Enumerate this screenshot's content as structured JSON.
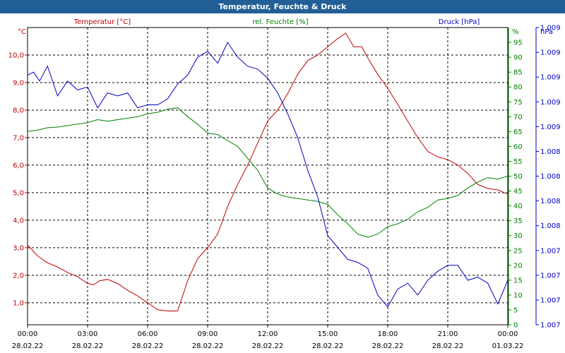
{
  "window": {
    "title": "Temperatur, Feuchte & Druck"
  },
  "colors": {
    "temperature": "#c00000",
    "humidity": "#008000",
    "pressure": "#0000c0",
    "grid": "#000000",
    "titlebar": "#215f96"
  },
  "chart_data": {
    "type": "line",
    "grid": "dashed, on",
    "x_ticks": [
      {
        "time": "00:00",
        "date": "28.02.22"
      },
      {
        "time": "03:00",
        "date": "28.02.22"
      },
      {
        "time": "06:00",
        "date": "28.02.22"
      },
      {
        "time": "09:00",
        "date": "28.02.22"
      },
      {
        "time": "12:00",
        "date": "28.02.22"
      },
      {
        "time": "15:00",
        "date": "28.02.22"
      },
      {
        "time": "18:00",
        "date": "28.02.22"
      },
      {
        "time": "21:00",
        "date": "28.02.22"
      },
      {
        "time": "00:00",
        "date": "01.03.22"
      }
    ],
    "x_range_hours": [
      0,
      24
    ],
    "axes": {
      "left": {
        "label": "Temperatur [°C]",
        "unit": "°C",
        "range": [
          0.2,
          11.0
        ],
        "ticks": [
          "1,0",
          "2,0",
          "3,0",
          "4,0",
          "5,0",
          "6,0",
          "7,0",
          "8,0",
          "9,0",
          "10,0"
        ]
      },
      "right1": {
        "label": "rel. Feuchte [%]",
        "unit": "%",
        "range": [
          0,
          100
        ],
        "ticks": [
          "0",
          "5",
          "10",
          "15",
          "20",
          "25",
          "30",
          "35",
          "40",
          "45",
          "50",
          "55",
          "60",
          "65",
          "70",
          "75",
          "80",
          "85",
          "90",
          "95"
        ]
      },
      "right2": {
        "label": "Druck [hPa]",
        "unit": "hPa",
        "range": [
          0,
          1
        ],
        "ticks": [
          "1.007",
          "1.007",
          "1.007",
          "1.007",
          "1.008",
          "1.008",
          "1.008",
          "1.008",
          "1.009",
          "1.009",
          "1.009",
          "1.009",
          "1.009"
        ]
      }
    },
    "series": [
      {
        "name": "Temperatur [°C]",
        "axis": "left",
        "points": [
          [
            0.0,
            3.1
          ],
          [
            0.5,
            2.7
          ],
          [
            1.0,
            2.45
          ],
          [
            1.5,
            2.3
          ],
          [
            2.0,
            2.1
          ],
          [
            2.5,
            1.95
          ],
          [
            3.0,
            1.7
          ],
          [
            3.3,
            1.65
          ],
          [
            3.6,
            1.8
          ],
          [
            4.0,
            1.85
          ],
          [
            4.5,
            1.7
          ],
          [
            5.0,
            1.45
          ],
          [
            5.5,
            1.25
          ],
          [
            6.0,
            1.0
          ],
          [
            6.5,
            0.75
          ],
          [
            7.0,
            0.7
          ],
          [
            7.5,
            0.7
          ],
          [
            8.0,
            1.8
          ],
          [
            8.5,
            2.6
          ],
          [
            9.0,
            3.0
          ],
          [
            9.5,
            3.5
          ],
          [
            10.0,
            4.5
          ],
          [
            10.5,
            5.3
          ],
          [
            11.0,
            6.0
          ],
          [
            11.5,
            6.8
          ],
          [
            12.0,
            7.6
          ],
          [
            12.5,
            8.0
          ],
          [
            13.0,
            8.6
          ],
          [
            13.5,
            9.3
          ],
          [
            14.0,
            9.8
          ],
          [
            14.5,
            10.0
          ],
          [
            15.0,
            10.3
          ],
          [
            15.5,
            10.6
          ],
          [
            15.9,
            10.8
          ],
          [
            16.3,
            10.3
          ],
          [
            16.7,
            10.3
          ],
          [
            17.0,
            9.9
          ],
          [
            17.5,
            9.3
          ],
          [
            18.0,
            8.8
          ],
          [
            18.5,
            8.2
          ],
          [
            19.0,
            7.6
          ],
          [
            19.5,
            7.0
          ],
          [
            20.0,
            6.5
          ],
          [
            20.5,
            6.3
          ],
          [
            21.0,
            6.2
          ],
          [
            21.5,
            6.0
          ],
          [
            22.0,
            5.7
          ],
          [
            22.5,
            5.3
          ],
          [
            23.0,
            5.15
          ],
          [
            23.5,
            5.1
          ],
          [
            24.0,
            4.95
          ]
        ]
      },
      {
        "name": "rel. Feuchte [%]",
        "axis": "right1",
        "points": [
          [
            0.0,
            65
          ],
          [
            0.5,
            65.5
          ],
          [
            1.0,
            66.3
          ],
          [
            1.5,
            66.5
          ],
          [
            2.0,
            67
          ],
          [
            2.5,
            67.5
          ],
          [
            3.0,
            68
          ],
          [
            3.5,
            69
          ],
          [
            4.0,
            68.5
          ],
          [
            4.5,
            69
          ],
          [
            5.0,
            69.5
          ],
          [
            5.5,
            70
          ],
          [
            6.0,
            71
          ],
          [
            6.5,
            71.5
          ],
          [
            7.0,
            72.5
          ],
          [
            7.5,
            73
          ],
          [
            8.0,
            70
          ],
          [
            8.5,
            67.5
          ],
          [
            9.0,
            64.5
          ],
          [
            9.5,
            64
          ],
          [
            10.0,
            62
          ],
          [
            10.5,
            60
          ],
          [
            11.0,
            56
          ],
          [
            11.5,
            52
          ],
          [
            12.0,
            46
          ],
          [
            12.5,
            44
          ],
          [
            13.0,
            43
          ],
          [
            13.5,
            42.5
          ],
          [
            14.0,
            42
          ],
          [
            14.5,
            41.5
          ],
          [
            15.0,
            40.5
          ],
          [
            15.5,
            37
          ],
          [
            16.0,
            34
          ],
          [
            16.5,
            30.5
          ],
          [
            17.0,
            29.5
          ],
          [
            17.5,
            30.5
          ],
          [
            18.0,
            33
          ],
          [
            18.5,
            34
          ],
          [
            19.0,
            35.5
          ],
          [
            19.5,
            38
          ],
          [
            20.0,
            39.5
          ],
          [
            20.5,
            42
          ],
          [
            21.0,
            42.5
          ],
          [
            21.5,
            43.5
          ],
          [
            22.0,
            46
          ],
          [
            22.5,
            48
          ],
          [
            23.0,
            49.5
          ],
          [
            23.5,
            49
          ],
          [
            24.0,
            50
          ]
        ]
      },
      {
        "name": "Druck [hPa]",
        "axis": "right2",
        "points": [
          [
            0.0,
            0.84
          ],
          [
            0.3,
            0.85
          ],
          [
            0.6,
            0.82
          ],
          [
            1.0,
            0.87
          ],
          [
            1.5,
            0.77
          ],
          [
            2.0,
            0.82
          ],
          [
            2.5,
            0.79
          ],
          [
            3.0,
            0.8
          ],
          [
            3.5,
            0.73
          ],
          [
            4.0,
            0.78
          ],
          [
            4.5,
            0.77
          ],
          [
            5.0,
            0.78
          ],
          [
            5.5,
            0.73
          ],
          [
            6.0,
            0.74
          ],
          [
            6.5,
            0.74
          ],
          [
            7.0,
            0.76
          ],
          [
            7.5,
            0.81
          ],
          [
            8.0,
            0.84
          ],
          [
            8.5,
            0.9
          ],
          [
            9.0,
            0.92
          ],
          [
            9.5,
            0.88
          ],
          [
            10.0,
            0.95
          ],
          [
            10.5,
            0.9
          ],
          [
            11.0,
            0.87
          ],
          [
            11.5,
            0.86
          ],
          [
            12.0,
            0.83
          ],
          [
            12.5,
            0.78
          ],
          [
            13.0,
            0.71
          ],
          [
            13.5,
            0.63
          ],
          [
            14.0,
            0.52
          ],
          [
            14.5,
            0.43
          ],
          [
            15.0,
            0.3
          ],
          [
            15.5,
            0.26
          ],
          [
            16.0,
            0.22
          ],
          [
            16.5,
            0.21
          ],
          [
            17.0,
            0.19
          ],
          [
            17.5,
            0.1
          ],
          [
            18.0,
            0.06
          ],
          [
            18.5,
            0.12
          ],
          [
            19.0,
            0.14
          ],
          [
            19.5,
            0.1
          ],
          [
            20.0,
            0.15
          ],
          [
            20.5,
            0.18
          ],
          [
            21.0,
            0.2
          ],
          [
            21.5,
            0.2
          ],
          [
            22.0,
            0.15
          ],
          [
            22.5,
            0.16
          ],
          [
            23.0,
            0.14
          ],
          [
            23.5,
            0.07
          ],
          [
            24.0,
            0.15
          ]
        ]
      }
    ]
  }
}
